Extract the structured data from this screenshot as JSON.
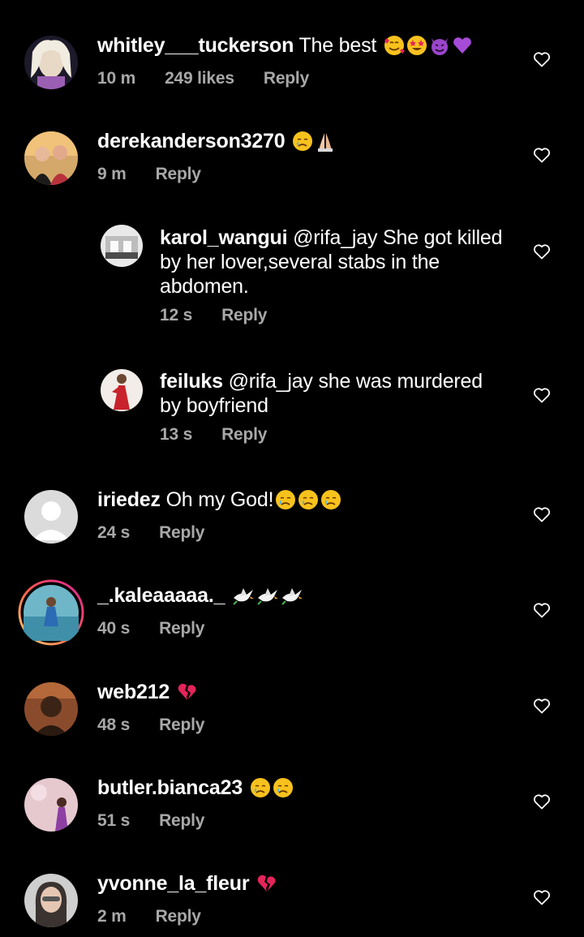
{
  "comments": [
    {
      "username": "whitley___tuckerson",
      "text": "The best",
      "emojis": [
        "smiling-hearts",
        "star-struck",
        "smiling-devil",
        "purple-heart"
      ],
      "time": "10 m",
      "likes": "249 likes",
      "reply": "Reply"
    },
    {
      "username": "derekanderson3270",
      "text": "",
      "emojis": [
        "crying-face",
        "folded-hands"
      ],
      "time": "9 m",
      "reply": "Reply"
    },
    {
      "username": "karol_wangui",
      "text_lines": [
        "@rifa_jay She got killed",
        "by her lover,several stabs in the",
        "abdomen."
      ],
      "time": "12 s",
      "reply": "Reply"
    },
    {
      "username": "feiluks",
      "text_lines": [
        "@rifa_jay she was murdered",
        "by boyfriend"
      ],
      "time": "13 s",
      "reply": "Reply"
    },
    {
      "username": "iriedez",
      "text": "Oh my God!",
      "emojis": [
        "crying-face",
        "crying-face",
        "crying-face"
      ],
      "time": "24 s",
      "reply": "Reply"
    },
    {
      "username": "_.kaleaaaaa._",
      "text": "",
      "emojis": [
        "dove",
        "dove",
        "dove"
      ],
      "time": "40 s",
      "reply": "Reply"
    },
    {
      "username": "web212",
      "text": "",
      "emojis": [
        "broken-heart"
      ],
      "time": "48 s",
      "reply": "Reply"
    },
    {
      "username": "butler.bianca23",
      "text": "",
      "emojis": [
        "crying-face",
        "crying-face"
      ],
      "time": "51 s",
      "reply": "Reply"
    },
    {
      "username": "yvonne_la_fleur",
      "text": "",
      "emojis": [
        "broken-heart"
      ],
      "time": "2 m",
      "reply": "Reply"
    }
  ],
  "colors": {
    "background": "#000000",
    "secondary_text": "#a8a8a8",
    "story_ring_start": "#d6249f",
    "story_ring_end": "#fd5949"
  },
  "icons": {
    "like": "heart-outline-icon"
  }
}
